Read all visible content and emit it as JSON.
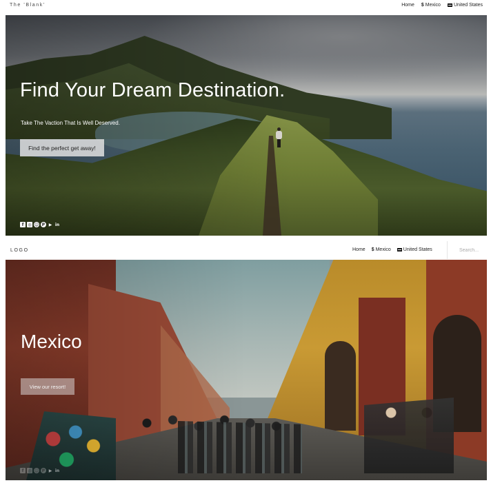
{
  "topnav": {
    "brand": "The 'Blank'",
    "links": [
      {
        "icon": "",
        "label": "Home"
      },
      {
        "icon": "$",
        "label": "Mexico"
      },
      {
        "icon": "mail-icon",
        "label": "United States"
      }
    ]
  },
  "hero1": {
    "title": "Find Your Dream Destination.",
    "subtitle": "Take The Vaction That Is Well Deserved.",
    "button": "Find the perfect get away!",
    "social_icons": [
      "facebook-icon",
      "instagram-icon",
      "snapchat-icon",
      "pinterest-icon",
      "twitter-icon",
      "linkedin-icon"
    ]
  },
  "nav2": {
    "logo": "LOGO",
    "links": [
      {
        "icon": "",
        "label": "Home"
      },
      {
        "icon": "$",
        "label": "Mexico"
      },
      {
        "icon": "mail-icon",
        "label": "United States"
      }
    ],
    "search_placeholder": "Search..."
  },
  "hero2": {
    "title": "Mexico",
    "button": "View our resort!",
    "social_icons": [
      "facebook-icon",
      "instagram-icon",
      "snapchat-icon",
      "pinterest-icon",
      "twitter-icon",
      "linkedin-icon"
    ]
  }
}
